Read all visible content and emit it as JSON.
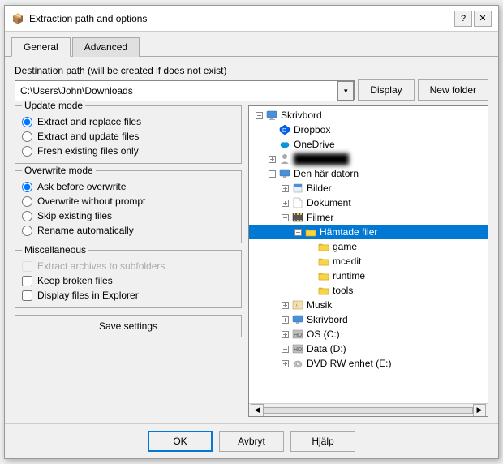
{
  "titleBar": {
    "icon": "📦",
    "title": "Extraction path and options",
    "helpBtn": "?",
    "closeBtn": "✕"
  },
  "tabs": [
    {
      "id": "general",
      "label": "General",
      "active": true
    },
    {
      "id": "advanced",
      "label": "Advanced",
      "active": false
    }
  ],
  "destination": {
    "label": "Destination path (will be created if does not exist)",
    "value": "C:\\Users\\John\\Downloads",
    "displayBtn": "Display",
    "newFolderBtn": "New folder"
  },
  "updateMode": {
    "title": "Update mode",
    "options": [
      {
        "id": "extract-replace",
        "label": "Extract and replace files",
        "checked": true
      },
      {
        "id": "extract-update",
        "label": "Extract and update files",
        "checked": false
      },
      {
        "id": "fresh-existing",
        "label": "Fresh existing files only",
        "checked": false
      }
    ]
  },
  "overwriteMode": {
    "title": "Overwrite mode",
    "options": [
      {
        "id": "ask-before",
        "label": "Ask before overwrite",
        "checked": true
      },
      {
        "id": "overwrite-no-prompt",
        "label": "Overwrite without prompt",
        "checked": false
      },
      {
        "id": "skip-existing",
        "label": "Skip existing files",
        "checked": false
      },
      {
        "id": "rename-auto",
        "label": "Rename automatically",
        "checked": false
      }
    ]
  },
  "miscellaneous": {
    "title": "Miscellaneous",
    "options": [
      {
        "id": "extract-subfolders",
        "label": "Extract archives to subfolders",
        "disabled": true,
        "checked": false
      },
      {
        "id": "keep-broken",
        "label": "Keep broken files",
        "disabled": false,
        "checked": false
      },
      {
        "id": "display-explorer",
        "label": "Display files in Explorer",
        "disabled": false,
        "checked": false
      }
    ]
  },
  "saveBtn": "Save settings",
  "fileTree": {
    "items": [
      {
        "indent": 0,
        "expander": "⊟",
        "hasCheck": false,
        "icon": "🖥",
        "label": "Skrivbord",
        "selected": false,
        "color": "#1a6fc4"
      },
      {
        "indent": 1,
        "expander": "",
        "hasCheck": false,
        "icon": "💧",
        "label": "Dropbox",
        "selected": false
      },
      {
        "indent": 1,
        "expander": "",
        "hasCheck": false,
        "icon": "☁",
        "label": "OneDrive",
        "selected": false
      },
      {
        "indent": 1,
        "expander": "⊞",
        "hasCheck": false,
        "icon": "👤",
        "label": "████████",
        "selected": false,
        "blurred": true
      },
      {
        "indent": 1,
        "expander": "⊟",
        "hasCheck": false,
        "icon": "🖥",
        "label": "Den här datorn",
        "selected": false
      },
      {
        "indent": 2,
        "expander": "⊞",
        "hasCheck": false,
        "icon": "🖼",
        "label": "Bilder",
        "selected": false
      },
      {
        "indent": 2,
        "expander": "⊞",
        "hasCheck": false,
        "icon": "📄",
        "label": "Dokument",
        "selected": false
      },
      {
        "indent": 2,
        "expander": "⊟",
        "hasCheck": false,
        "icon": "🎬",
        "label": "Filmer",
        "selected": false
      },
      {
        "indent": 3,
        "expander": "⊟",
        "hasCheck": false,
        "icon": "📁",
        "label": "Hämtade filer",
        "selected": true
      },
      {
        "indent": 4,
        "expander": "",
        "hasCheck": false,
        "icon": "📁",
        "label": "game",
        "selected": false
      },
      {
        "indent": 4,
        "expander": "",
        "hasCheck": false,
        "icon": "📁",
        "label": "mcedit",
        "selected": false
      },
      {
        "indent": 4,
        "expander": "",
        "hasCheck": false,
        "icon": "📁",
        "label": "runtime",
        "selected": false
      },
      {
        "indent": 4,
        "expander": "",
        "hasCheck": false,
        "icon": "📁",
        "label": "tools",
        "selected": false
      },
      {
        "indent": 2,
        "expander": "⊞",
        "hasCheck": false,
        "icon": "🎵",
        "label": "Musik",
        "selected": false
      },
      {
        "indent": 2,
        "expander": "⊞",
        "hasCheck": false,
        "icon": "🖥",
        "label": "Skrivbord",
        "selected": false
      },
      {
        "indent": 2,
        "expander": "⊞",
        "hasCheck": false,
        "icon": "💾",
        "label": "OS (C:)",
        "selected": false
      },
      {
        "indent": 2,
        "expander": "⊟",
        "hasCheck": false,
        "icon": "💾",
        "label": "Data (D:)",
        "selected": false
      },
      {
        "indent": 2,
        "expander": "⊞",
        "hasCheck": false,
        "icon": "💿",
        "label": "DVD RW enhet (E:)",
        "selected": false
      }
    ]
  },
  "bottomBar": {
    "okBtn": "OK",
    "cancelBtn": "Avbryt",
    "helpBtn": "Hjälp"
  }
}
